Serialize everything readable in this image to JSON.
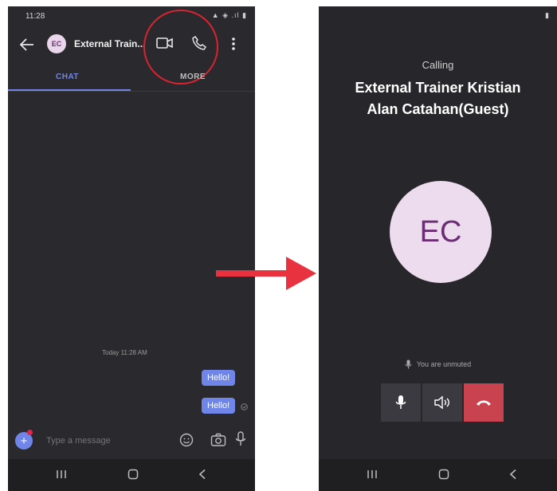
{
  "left_screen": {
    "status_time": "11:28",
    "status_icons": "▲ ◈ .ıl ▮",
    "contact_initials": "EC",
    "contact_name": "External Train...",
    "tabs": [
      {
        "label": "CHAT",
        "active": true
      },
      {
        "label": "MORE",
        "active": false
      }
    ],
    "timestamp": "Today 11:28 AM",
    "messages": [
      "Hello!",
      "Hello!"
    ],
    "composer_placeholder": "Type a message"
  },
  "right_screen": {
    "status_icons": "▮",
    "calling_label": "Calling",
    "callee_name_line1": "External Trainer Kristian",
    "callee_name_line2": "Alan Catahan(Guest)",
    "callee_initials": "EC",
    "mute_status": "You are unmuted"
  },
  "colors": {
    "accent": "#6f86e8",
    "annotation_red": "#d92430",
    "hangup": "#c9434f",
    "avatar_bg": "#ecdcee",
    "avatar_text": "#6b2d73"
  }
}
